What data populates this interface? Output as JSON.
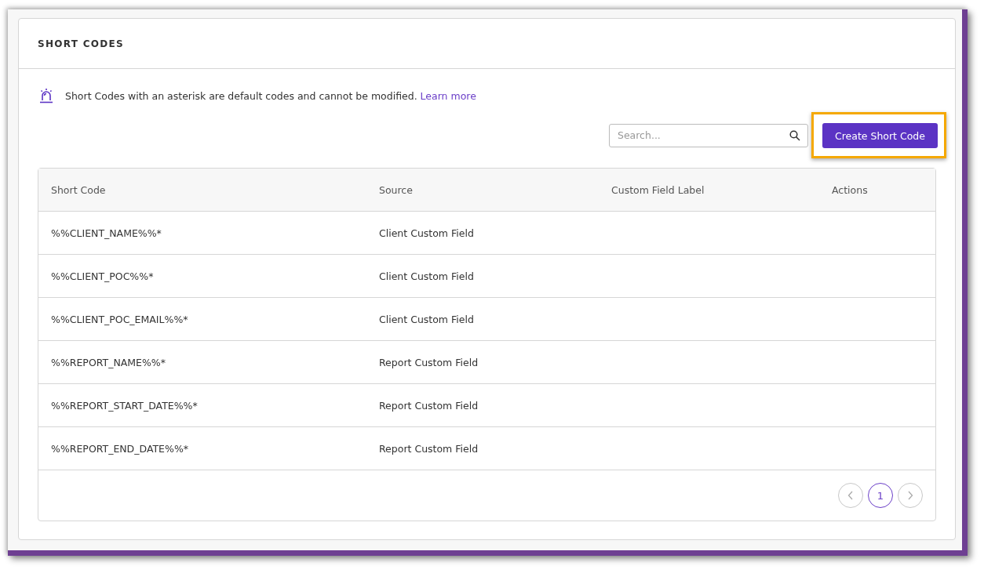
{
  "card": {
    "title": "SHORT CODES"
  },
  "notice": {
    "text": "Short Codes with an asterisk are default codes and cannot be modified.",
    "link": "Learn more"
  },
  "search": {
    "placeholder": "Search..."
  },
  "create_button": {
    "label": "Create Short Code",
    "highlighted": true
  },
  "table": {
    "columns": [
      "Short Code",
      "Source",
      "Custom Field Label",
      "Actions"
    ],
    "rows": [
      {
        "cells": [
          "%%CLIENT_NAME%%*",
          "Client Custom Field"
        ]
      },
      {
        "cells": [
          "%%CLIENT_POC%%*",
          "Client Custom Field"
        ]
      },
      {
        "cells": [
          "%%CLIENT_POC_EMAIL%%*",
          "Client Custom Field"
        ]
      },
      {
        "cells": [
          "%%REPORT_NAME%%*",
          "Report Custom Field"
        ]
      },
      {
        "cells": [
          "%%REPORT_START_DATE%%*",
          "Report Custom Field"
        ]
      },
      {
        "cells": [
          "%%REPORT_END_DATE%%*",
          "Report Custom Field"
        ]
      }
    ]
  },
  "pagination": {
    "pages": [
      {
        "label": "1",
        "selected": true
      }
    ]
  }
}
